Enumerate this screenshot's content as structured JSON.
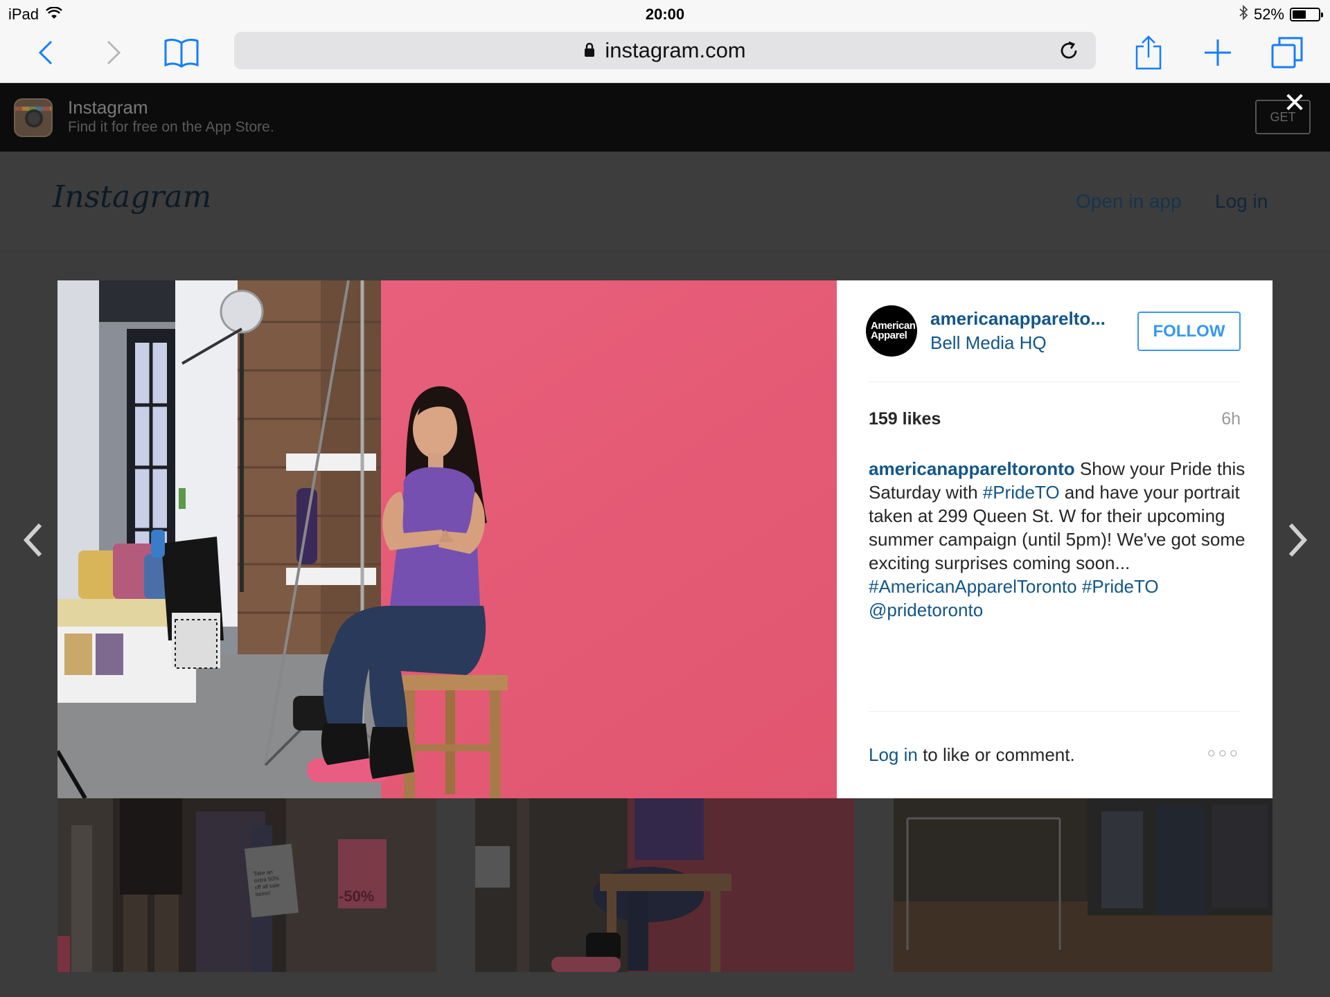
{
  "status": {
    "device": "iPad",
    "time": "20:00",
    "battery": "52%",
    "battery_level": 0.52
  },
  "browser": {
    "url": "instagram.com"
  },
  "app_banner": {
    "name": "Instagram",
    "subtitle": "Find it for free on the App Store.",
    "get_label": "GET",
    "close": "✕"
  },
  "ig_header": {
    "logo": "Instagram",
    "open_in_app": "Open in app",
    "log_in": "Log in"
  },
  "post": {
    "avatar_text": "American Apparel",
    "username": "americanapparelto...",
    "location": "Bell Media HQ",
    "follow_label": "FOLLOW",
    "likes": "159 likes",
    "time_ago": "6h",
    "caption": {
      "user": "americanappareltoronto",
      "t1": " Show your Pride this Saturday with ",
      "h1": "#PrideTO",
      "t2": " and have your portrait taken at 299 Queen St. W for their upcoming summer campaign (until 5pm)! We've got some exciting surprises coming soon... ",
      "h2": "#AmericanApparelToronto",
      "h3": "#PrideTO",
      "h4": "@pridetoronto"
    },
    "footer_link": "Log in",
    "footer_text": " to like or comment.",
    "more": "○○○"
  },
  "grid": {
    "tile1_sign": "Take an extra 50% off all sale items!",
    "tile1_discount": "-50%"
  },
  "colors": {
    "link": "#125688",
    "follow": "#3897f0",
    "photo_backdrop": "#e65f7d"
  }
}
